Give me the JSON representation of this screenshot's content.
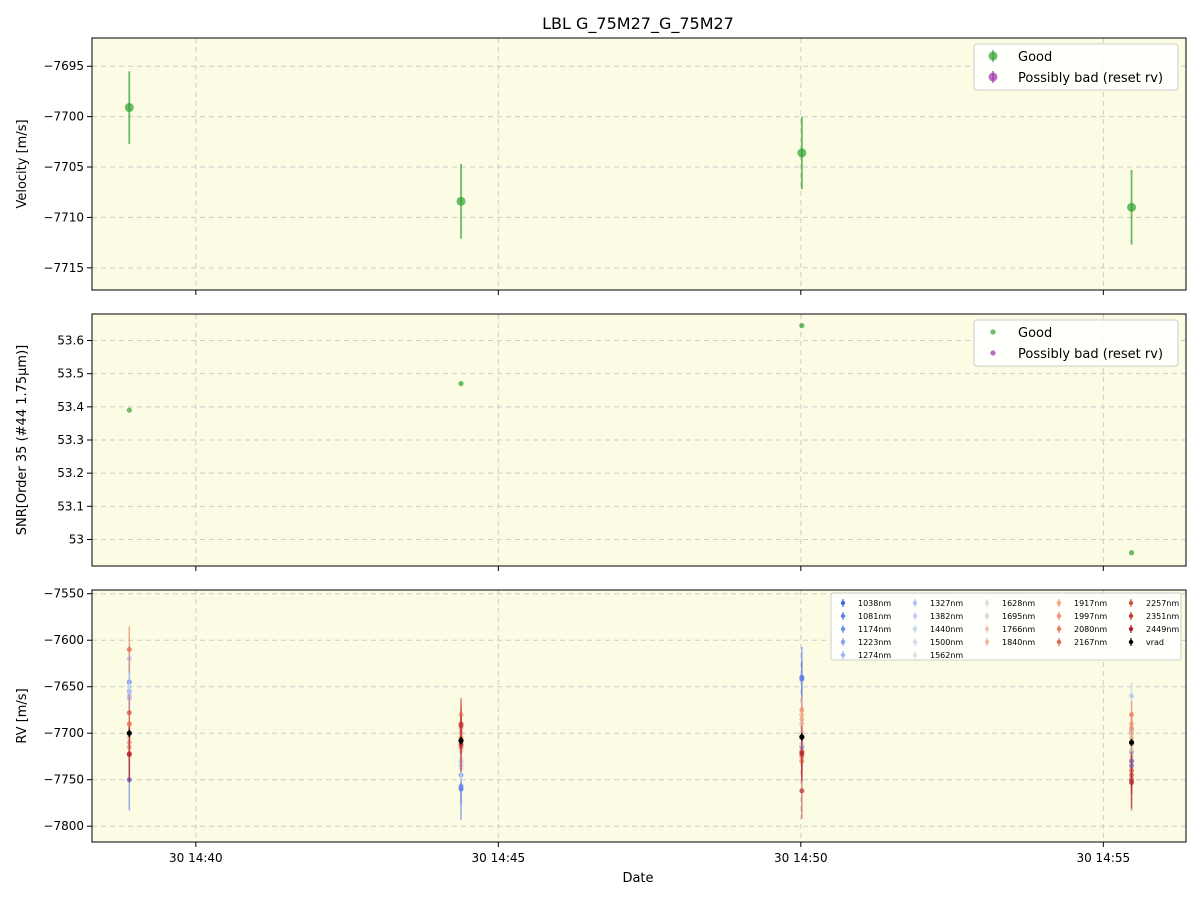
{
  "title": "LBL G_75M27_G_75M27",
  "xlabel": "Date",
  "colors": {
    "panel_bg": "#fcfbe3",
    "good": "#2ca02c",
    "bad": "#9b2fa6",
    "grid": "#cccccc",
    "vrad": "#000000"
  },
  "x_ticks": [
    "30 14:40",
    "30 14:45",
    "30 14:50",
    "30 14:55"
  ],
  "chart_data": [
    {
      "type": "scatter",
      "ylabel": "Velocity [m/s]",
      "xlim": [
        "14:38:17",
        "14:56:22"
      ],
      "ylim": [
        -7717.2,
        -7692.2
      ],
      "yticks": [
        -7695,
        -7700,
        -7705,
        -7710,
        -7715
      ],
      "grid": true,
      "legend": {
        "placement": "top-right",
        "entries": [
          "Good",
          "Possibly bad (reset rv)"
        ]
      },
      "series": [
        {
          "name": "Good",
          "x": [
            "14:38:54",
            "14:44:23",
            "14:50:01",
            "14:55:28"
          ],
          "y": [
            -7699.1,
            -7708.4,
            -7703.6,
            -7709.0
          ],
          "yerr": [
            3.6,
            3.7,
            3.6,
            3.7
          ]
        },
        {
          "name": "Possibly bad (reset rv)",
          "x": [],
          "y": [],
          "yerr": []
        }
      ]
    },
    {
      "type": "scatter",
      "ylabel": "SNR[Order 35 (#44 1.75μm)]",
      "xlim": [
        "14:38:17",
        "14:56:22"
      ],
      "ylim": [
        52.92,
        53.68
      ],
      "yticks": [
        53.0,
        53.1,
        53.2,
        53.3,
        53.4,
        53.5,
        53.6
      ],
      "grid": true,
      "legend": {
        "placement": "top-right",
        "entries": [
          "Good",
          "Possibly bad (reset rv)"
        ]
      },
      "series": [
        {
          "name": "Good",
          "x": [
            "14:38:54",
            "14:44:23",
            "14:50:01",
            "14:55:28"
          ],
          "y": [
            53.39,
            53.47,
            53.645,
            52.96
          ]
        },
        {
          "name": "Possibly bad (reset rv)",
          "x": [],
          "y": []
        }
      ]
    },
    {
      "type": "scatter",
      "ylabel": "RV [m/s]",
      "xlim": [
        "14:38:17",
        "14:56:22"
      ],
      "ylim": [
        -7817,
        -7546
      ],
      "yticks": [
        -7550,
        -7600,
        -7650,
        -7700,
        -7750,
        -7800
      ],
      "grid": true,
      "legend": {
        "placement": "top-right",
        "columns": [
          [
            "1038nm",
            "1081nm",
            "1174nm",
            "1223nm",
            "1274nm"
          ],
          [
            "1327nm",
            "1382nm",
            "1440nm",
            "1500nm",
            "1562nm"
          ],
          [
            "1628nm",
            "1695nm",
            "1766nm",
            "1840nm"
          ],
          [
            "1917nm",
            "1997nm",
            "2080nm",
            "2167nm"
          ],
          [
            "2257nm",
            "2351nm",
            "2449nm",
            "vrad"
          ]
        ],
        "colors": {
          "1038nm": "#4466e6",
          "1081nm": "#5a7eee",
          "1174nm": "#7090f2",
          "1223nm": "#86a3f4",
          "1274nm": "#9cb4f5",
          "1327nm": "#afc4f4",
          "1382nm": "#bdd0f3",
          "1440nm": "#c9d8f0",
          "1500nm": "#d5ddeb",
          "1562nm": "#dcdfe6",
          "1628nm": "#e4dcd8",
          "1695nm": "#ebd3c6",
          "1766nm": "#f0c5b2",
          "1840nm": "#f2b59d",
          "1917nm": "#f3a587",
          "1997nm": "#f09371",
          "2080nm": "#ea7e5d",
          "2167nm": "#e0684c",
          "2257nm": "#d4523e",
          "2351nm": "#c53a34",
          "2449nm": "#b3202e",
          "vrad": "#000000"
        }
      },
      "series": [
        {
          "name": "1038nm",
          "x": [
            "14:38:54",
            "14:44:23",
            "14:50:01",
            "14:55:28"
          ],
          "y": [
            -7750,
            -7760,
            -7640,
            -7730
          ],
          "yerr": [
            33,
            33,
            33,
            30
          ]
        },
        {
          "name": "1081nm",
          "x": [
            "14:38:54",
            "14:44:23",
            "14:50:01",
            "14:55:28"
          ],
          "y": [
            -7645,
            -7757,
            -7642,
            -7735
          ],
          "yerr": [
            20,
            20,
            20,
            20
          ]
        },
        {
          "name": "1174nm",
          "x": [
            "14:38:54",
            "14:44:23",
            "14:50:01",
            "14:55:28"
          ],
          "y": [
            -7660,
            -7745,
            -7715,
            -7720
          ],
          "yerr": [
            20,
            20,
            20,
            20
          ]
        },
        {
          "name": "1223nm",
          "x": [
            "14:38:54",
            "14:44:23",
            "14:50:01",
            "14:55:28"
          ],
          "y": [
            -7655,
            -7735,
            -7720,
            -7700
          ],
          "yerr": [
            18,
            18,
            18,
            18
          ]
        },
        {
          "name": "1274nm",
          "x": [
            "14:38:54",
            "14:44:23",
            "14:50:01",
            "14:55:28"
          ],
          "y": [
            -7662,
            -7730,
            -7712,
            -7698
          ],
          "yerr": [
            18,
            18,
            18,
            18
          ]
        },
        {
          "name": "1327nm",
          "x": [
            "14:38:54",
            "14:44:23",
            "14:50:01",
            "14:55:28"
          ],
          "y": [
            -7620,
            -7700,
            -7690,
            -7660
          ],
          "yerr": [
            15,
            15,
            15,
            15
          ]
        },
        {
          "name": "1382nm",
          "x": [
            "14:38:54",
            "14:44:23",
            "14:50:01",
            "14:55:28"
          ],
          "y": [
            -7650,
            -7690,
            -7700,
            -7695
          ],
          "yerr": [
            15,
            15,
            15,
            15
          ]
        },
        {
          "name": "1440nm",
          "x": [
            "14:38:54",
            "14:44:23",
            "14:50:01",
            "14:55:28"
          ],
          "y": [
            -7660,
            -7720,
            -7705,
            -7700
          ],
          "yerr": [
            15,
            15,
            15,
            15
          ]
        },
        {
          "name": "1500nm",
          "x": [
            "14:38:54",
            "14:44:23",
            "14:50:01",
            "14:55:28"
          ],
          "y": [
            -7690,
            -7735,
            -7712,
            -7705
          ],
          "yerr": [
            15,
            15,
            15,
            15
          ]
        },
        {
          "name": "1562nm",
          "x": [
            "14:38:54",
            "14:44:23",
            "14:50:01",
            "14:55:28"
          ],
          "y": [
            -7700,
            -7738,
            -7700,
            -7725
          ],
          "yerr": [
            15,
            15,
            15,
            15
          ]
        },
        {
          "name": "1628nm",
          "x": [
            "14:38:54",
            "14:44:23",
            "14:50:01",
            "14:55:28"
          ],
          "y": [
            -7710,
            -7728,
            -7706,
            -7718
          ],
          "yerr": [
            15,
            15,
            15,
            15
          ]
        },
        {
          "name": "1695nm",
          "x": [
            "14:38:54",
            "14:44:23",
            "14:50:01",
            "14:55:28"
          ],
          "y": [
            -7705,
            -7718,
            -7700,
            -7712
          ],
          "yerr": [
            15,
            15,
            15,
            15
          ]
        },
        {
          "name": "1766nm",
          "x": [
            "14:38:54",
            "14:44:23",
            "14:50:01",
            "14:55:28"
          ],
          "y": [
            -7700,
            -7710,
            -7690,
            -7705
          ],
          "yerr": [
            15,
            15,
            15,
            15
          ]
        },
        {
          "name": "1840nm",
          "x": [
            "14:38:54",
            "14:44:23",
            "14:50:01",
            "14:55:28"
          ],
          "y": [
            -7690,
            -7700,
            -7680,
            -7700
          ],
          "yerr": [
            15,
            15,
            15,
            15
          ]
        },
        {
          "name": "1917nm",
          "x": [
            "14:38:54",
            "14:44:23",
            "14:50:01",
            "14:55:28"
          ],
          "y": [
            -7710,
            -7695,
            -7685,
            -7690
          ],
          "yerr": [
            15,
            15,
            15,
            15
          ]
        },
        {
          "name": "1997nm",
          "x": [
            "14:38:54",
            "14:44:23",
            "14:50:01",
            "14:55:28"
          ],
          "y": [
            -7715,
            -7680,
            -7675,
            -7695
          ],
          "yerr": [
            15,
            15,
            15,
            15
          ]
        },
        {
          "name": "2080nm",
          "x": [
            "14:38:54",
            "14:44:23",
            "14:50:01",
            "14:55:28"
          ],
          "y": [
            -7690,
            -7705,
            -7730,
            -7680
          ],
          "yerr": [
            15,
            15,
            15,
            15
          ]
        },
        {
          "name": "2167nm",
          "x": [
            "14:38:54",
            "14:44:23",
            "14:50:01",
            "14:55:28"
          ],
          "y": [
            -7610,
            -7715,
            -7725,
            -7740
          ],
          "yerr": [
            25,
            25,
            25,
            25
          ]
        },
        {
          "name": "2257nm",
          "x": [
            "14:38:54",
            "14:44:23",
            "14:50:01",
            "14:55:28"
          ],
          "y": [
            -7678,
            -7690,
            -7720,
            -7745
          ],
          "yerr": [
            20,
            20,
            20,
            20
          ]
        },
        {
          "name": "2351nm",
          "x": [
            "14:38:54",
            "14:44:23",
            "14:50:01",
            "14:55:28"
          ],
          "y": [
            -7722,
            -7692,
            -7762,
            -7750
          ],
          "yerr": [
            30,
            30,
            30,
            30
          ]
        },
        {
          "name": "2449nm",
          "x": [
            "14:38:54",
            "14:44:23",
            "14:50:01",
            "14:55:28"
          ],
          "y": [
            -7723,
            -7712,
            -7722,
            -7753
          ],
          "yerr": [
            30,
            30,
            30,
            30
          ]
        },
        {
          "name": "vrad",
          "x": [
            "14:38:54",
            "14:44:23",
            "14:50:01",
            "14:55:28"
          ],
          "y": [
            -7700,
            -7708,
            -7704,
            -7710
          ],
          "yerr": [
            4,
            4,
            4,
            4
          ]
        }
      ]
    }
  ]
}
